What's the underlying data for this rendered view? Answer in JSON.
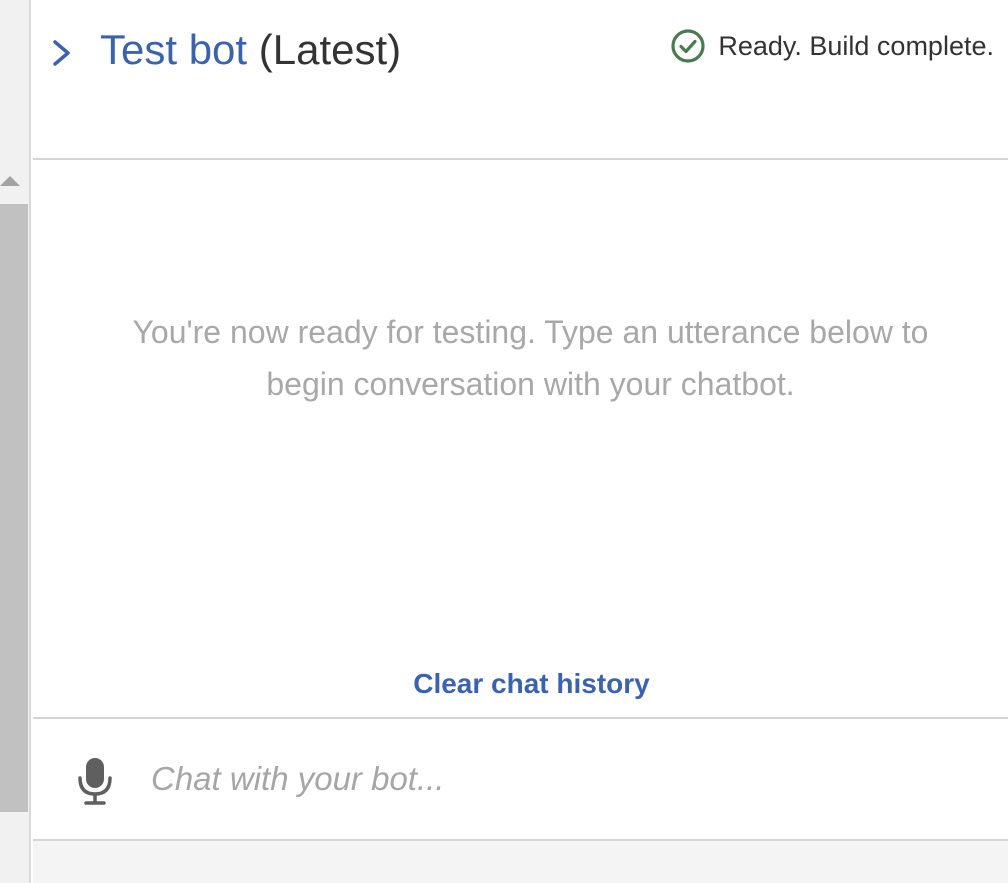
{
  "header": {
    "bot_name": "Test bot",
    "version_label": "(Latest)",
    "status_text": "Ready. Build complete.",
    "status_color": "#4a7a4f"
  },
  "conversation": {
    "empty_message": "You're now ready for testing. Type an utterance below to begin conversation with your chatbot.",
    "clear_history_label": "Clear chat history"
  },
  "composer": {
    "placeholder": "Chat with your bot...",
    "value": ""
  },
  "icons": {
    "expand": "chevron-right-icon",
    "status": "check-circle-icon",
    "mic": "microphone-icon"
  },
  "colors": {
    "accent": "#3b63ad",
    "muted_text": "#a8a8a8"
  }
}
